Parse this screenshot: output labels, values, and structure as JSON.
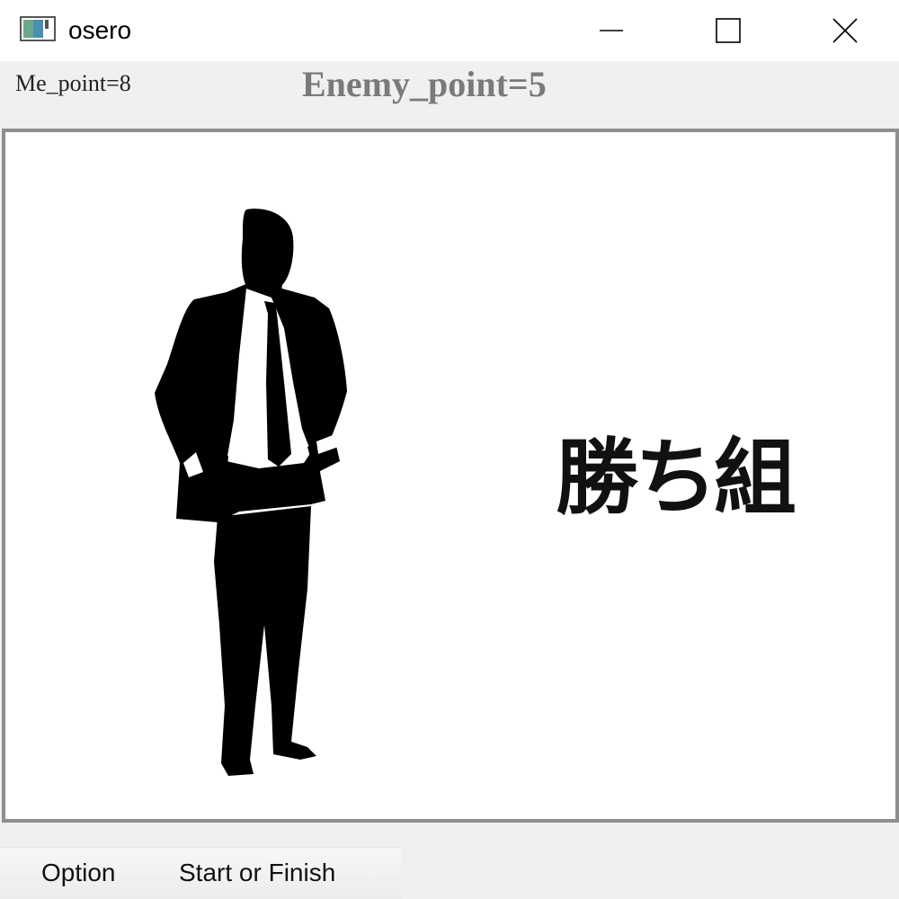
{
  "window": {
    "title": "osero",
    "controls": {
      "minimize_icon": "minimize-icon",
      "maximize_icon": "maximize-icon",
      "close_icon": "close-icon"
    }
  },
  "scores": {
    "me": "Me_point=8",
    "enemy": "Enemy_point=5"
  },
  "board": {
    "image": "businessman-silhouette",
    "result_text": "勝ち組"
  },
  "menu": {
    "items": [
      {
        "label": "Option"
      },
      {
        "label": "Start or Finish"
      }
    ]
  },
  "colors": {
    "title_bar": "#ffffff",
    "background": "#f0f0f0",
    "board_border": "#8e8e8e",
    "enemy_text": "#7a7a7a"
  }
}
